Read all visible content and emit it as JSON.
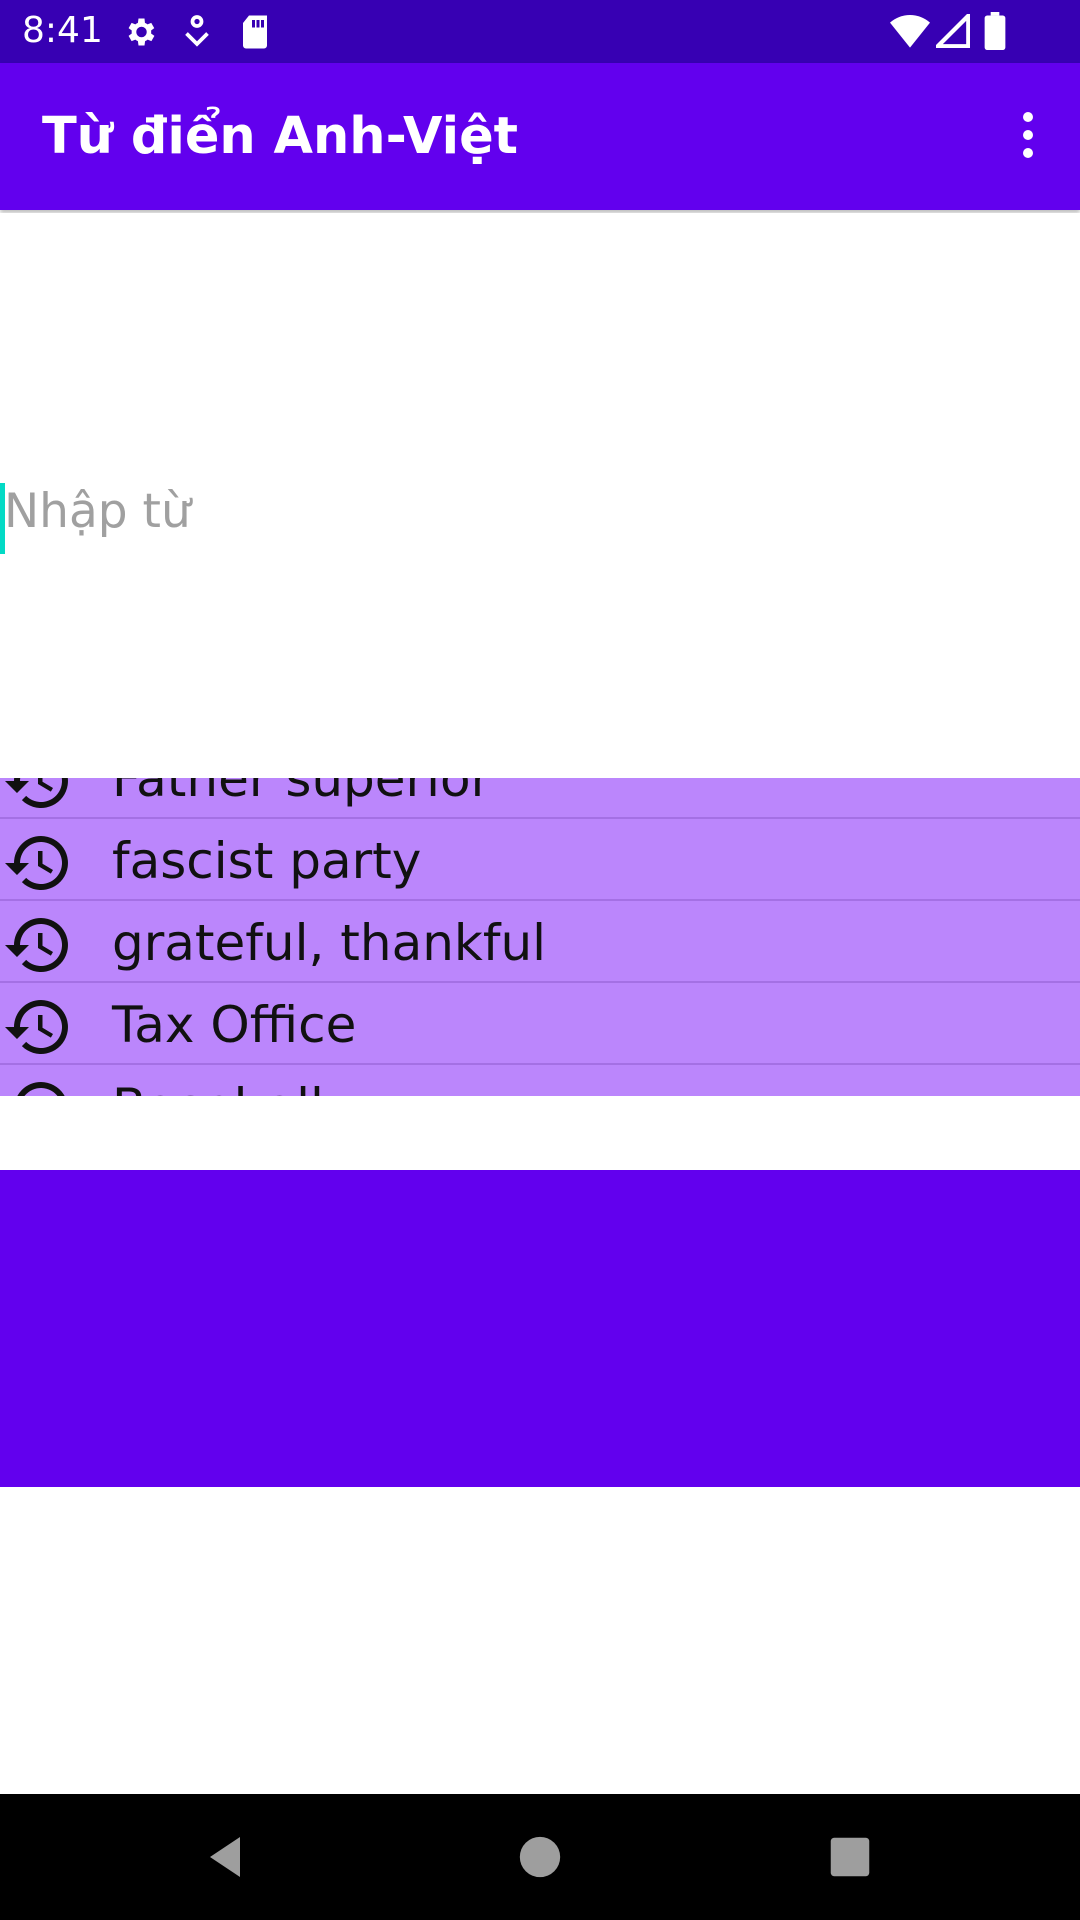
{
  "status_bar": {
    "time": "8:41",
    "icons": [
      "settings-icon",
      "notification-icon",
      "sd-card-icon",
      "wifi-icon",
      "signal-icon",
      "battery-icon"
    ]
  },
  "app_bar": {
    "title": "Từ điển Anh-Việt",
    "menu_icon": "more-vert-icon"
  },
  "search": {
    "placeholder": "Nhập từ",
    "value": ""
  },
  "history": {
    "icon": "history-icon",
    "items": [
      {
        "label": "Father superior"
      },
      {
        "label": "fascist party"
      },
      {
        "label": "grateful, thankful"
      },
      {
        "label": "Tax Office"
      },
      {
        "label": "Baseball"
      }
    ]
  },
  "colors": {
    "status_bar": "#3700b3",
    "primary": "#6200ee",
    "list_bg": "#bb86fc",
    "accent": "#03dac5"
  },
  "nav_bar": {
    "icons": [
      "back-icon",
      "home-icon",
      "recents-icon"
    ]
  }
}
